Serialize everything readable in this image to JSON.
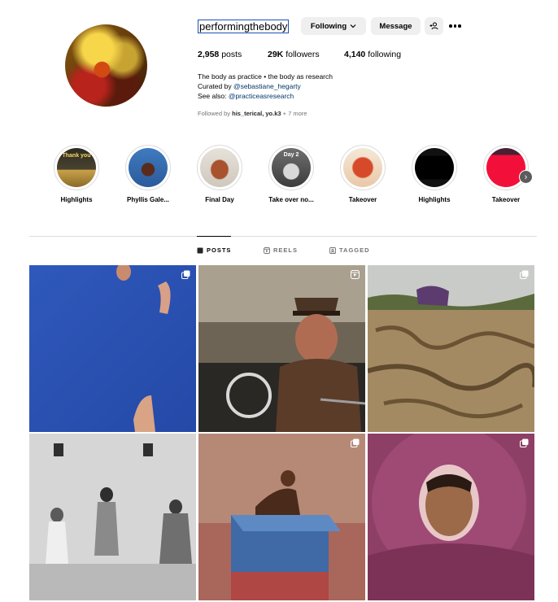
{
  "profile": {
    "username": "performingthebody",
    "following_label": "Following",
    "message_label": "Message",
    "stats": {
      "posts_count": "2,958",
      "posts_label": "posts",
      "followers_count": "29K",
      "followers_label": "followers",
      "following_count": "4,140",
      "following_label": "following"
    },
    "bio": {
      "line1": "The body as practice • the body as research",
      "line2_prefix": "Curated by ",
      "line2_link": "@sebastiane_hegarty",
      "line3_prefix": "See also: ",
      "line3_link": "@practiceasresearch"
    },
    "followed_by": {
      "prefix": "Followed by ",
      "names": "his_terical, yo.k3",
      "suffix": " + 7 more"
    }
  },
  "highlights": [
    {
      "label": "Highlights",
      "overlay": "Thank you"
    },
    {
      "label": "Phyllis Gale...",
      "overlay": ""
    },
    {
      "label": "Final Day",
      "overlay": ""
    },
    {
      "label": "Take over no...",
      "overlay": "Day 2"
    },
    {
      "label": "Takeover",
      "overlay": ""
    },
    {
      "label": "Highlights",
      "overlay": ""
    },
    {
      "label": "Takeover",
      "overlay": ""
    }
  ],
  "tabs": {
    "posts": "POSTS",
    "reels": "REELS",
    "tagged": "TAGGED"
  },
  "icons": {
    "chevron": "chevron-down-icon",
    "add_user": "add-user-icon",
    "more": "more-options-icon",
    "next": "chevron-right-icon"
  },
  "colors": {
    "button_bg": "#efefef",
    "link": "#00376b",
    "muted": "#737373"
  }
}
